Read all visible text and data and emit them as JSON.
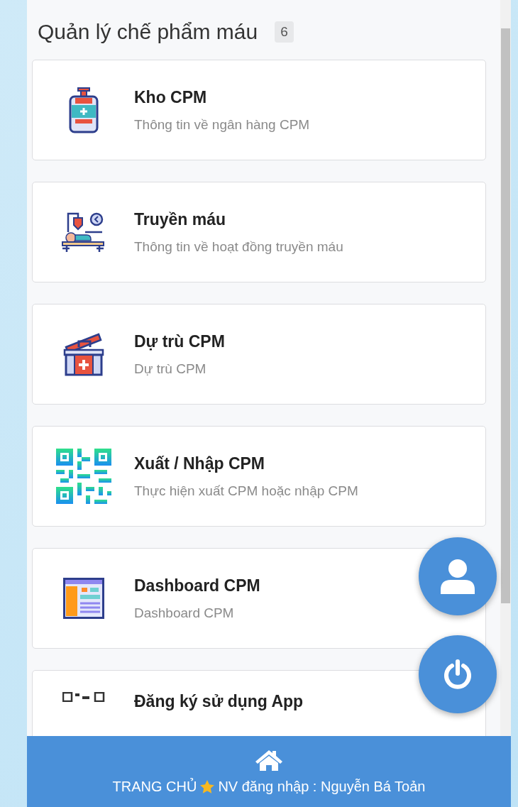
{
  "header": {
    "title": "Quản lý chế phẩm máu",
    "count": "6"
  },
  "items": [
    {
      "kind": "blood-bag",
      "title": "Kho CPM",
      "description": "Thông tin về ngân hàng CPM"
    },
    {
      "kind": "transfusion",
      "title": "Truyền máu",
      "description": "Thông tin về hoạt đồng truyền máu"
    },
    {
      "kind": "kit",
      "title": "Dự trù CPM",
      "description": "Dự trù CPM"
    },
    {
      "kind": "qr",
      "title": "Xuất / Nhập CPM",
      "description": "Thực hiện xuất CPM hoặc nhập CPM"
    },
    {
      "kind": "dashboard",
      "title": "Dashboard CPM",
      "description": "Dashboard CPM"
    },
    {
      "kind": "qr-small",
      "title": "Đăng ký sử dụng App"
    }
  ],
  "footer": {
    "home": "TRANG CHỦ",
    "login": "NV đăng nhập : Nguyễn Bá Toản"
  }
}
